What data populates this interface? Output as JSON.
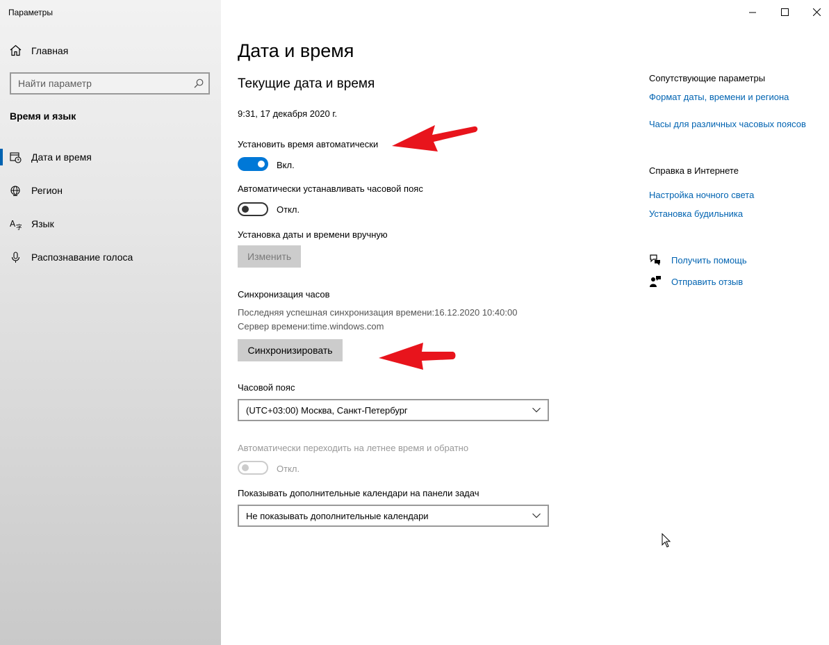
{
  "app_title": "Параметры",
  "sidebar": {
    "home_label": "Главная",
    "search_placeholder": "Найти параметр",
    "section_title": "Время и язык",
    "items": [
      {
        "label": "Дата и время",
        "icon": "clock-calendar-icon"
      },
      {
        "label": "Регион",
        "icon": "globe-icon"
      },
      {
        "label": "Язык",
        "icon": "language-icon"
      },
      {
        "label": "Распознавание голоса",
        "icon": "microphone-icon"
      }
    ]
  },
  "main": {
    "page_title": "Дата и время",
    "sub_title": "Текущие дата и время",
    "current_datetime": "9:31, 17 декабря 2020 г.",
    "auto_time_label": "Установить время автоматически",
    "auto_time_state": "Вкл.",
    "auto_tz_label": "Автоматически устанавливать часовой пояс",
    "auto_tz_state": "Откл.",
    "manual_label": "Установка даты и времени вручную",
    "change_button": "Изменить",
    "sync_title": "Синхронизация часов",
    "last_sync": "Последняя успешная синхронизация времени:16.12.2020 10:40:00",
    "time_server": "Сервер времени:time.windows.com",
    "sync_button": "Синхронизировать",
    "timezone_label": "Часовой пояс",
    "timezone_value": "(UTC+03:00) Москва, Санкт-Петербург",
    "dst_label": "Автоматически переходить на летнее время и обратно",
    "dst_state": "Откл.",
    "calendars_label": "Показывать дополнительные календари на панели задач",
    "calendars_value": "Не показывать дополнительные календари"
  },
  "right": {
    "related_title": "Сопутствующие параметры",
    "related_links": [
      "Формат даты, времени и региона",
      "Часы для различных часовых поясов"
    ],
    "help_title": "Справка в Интернете",
    "help_links": [
      "Настройка ночного света",
      "Установка будильника"
    ],
    "get_help": "Получить помощь",
    "feedback": "Отправить отзыв"
  },
  "colors": {
    "accent": "#0078d7",
    "link": "#0063b1",
    "annotation_arrow": "#e8141c"
  }
}
